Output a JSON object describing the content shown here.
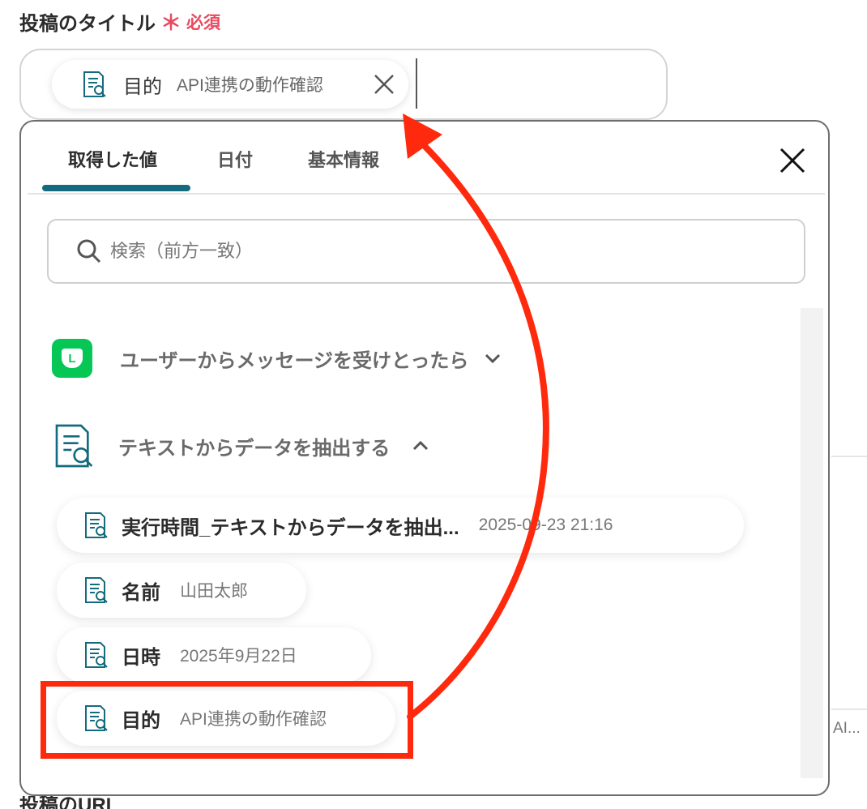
{
  "field": {
    "label": "投稿のタイトル",
    "required_mark": "＊",
    "required_text": "必須"
  },
  "selected_chip": {
    "name": "目的",
    "value": "API連携の動作確認"
  },
  "tabs": [
    {
      "label": "取得した値",
      "active": true
    },
    {
      "label": "日付",
      "active": false
    },
    {
      "label": "基本情報",
      "active": false
    }
  ],
  "search": {
    "placeholder": "検索（前方一致）"
  },
  "sections": [
    {
      "label": "ユーザーからメッセージを受けとったら",
      "icon": "line-app-icon",
      "expanded": false
    },
    {
      "label": "テキストからデータを抽出する",
      "icon": "document-search-icon",
      "expanded": true
    }
  ],
  "line_icon_letter": "L",
  "items": [
    {
      "name": "実行時間_テキストからデータを抽出...",
      "value": "2025-09-23 21:16"
    },
    {
      "name": "名前",
      "value": "山田太郎"
    },
    {
      "name": "日時",
      "value": "2025年9月22日"
    },
    {
      "name": "目的",
      "value": "API連携の動作確認"
    }
  ],
  "background": {
    "truncated_text": "AI...",
    "next_field_label": "投稿のURL"
  },
  "colors": {
    "accent": "#156b7e",
    "required": "#e84a5f",
    "annotation": "#ff2a0d",
    "line_green": "#06c755"
  }
}
